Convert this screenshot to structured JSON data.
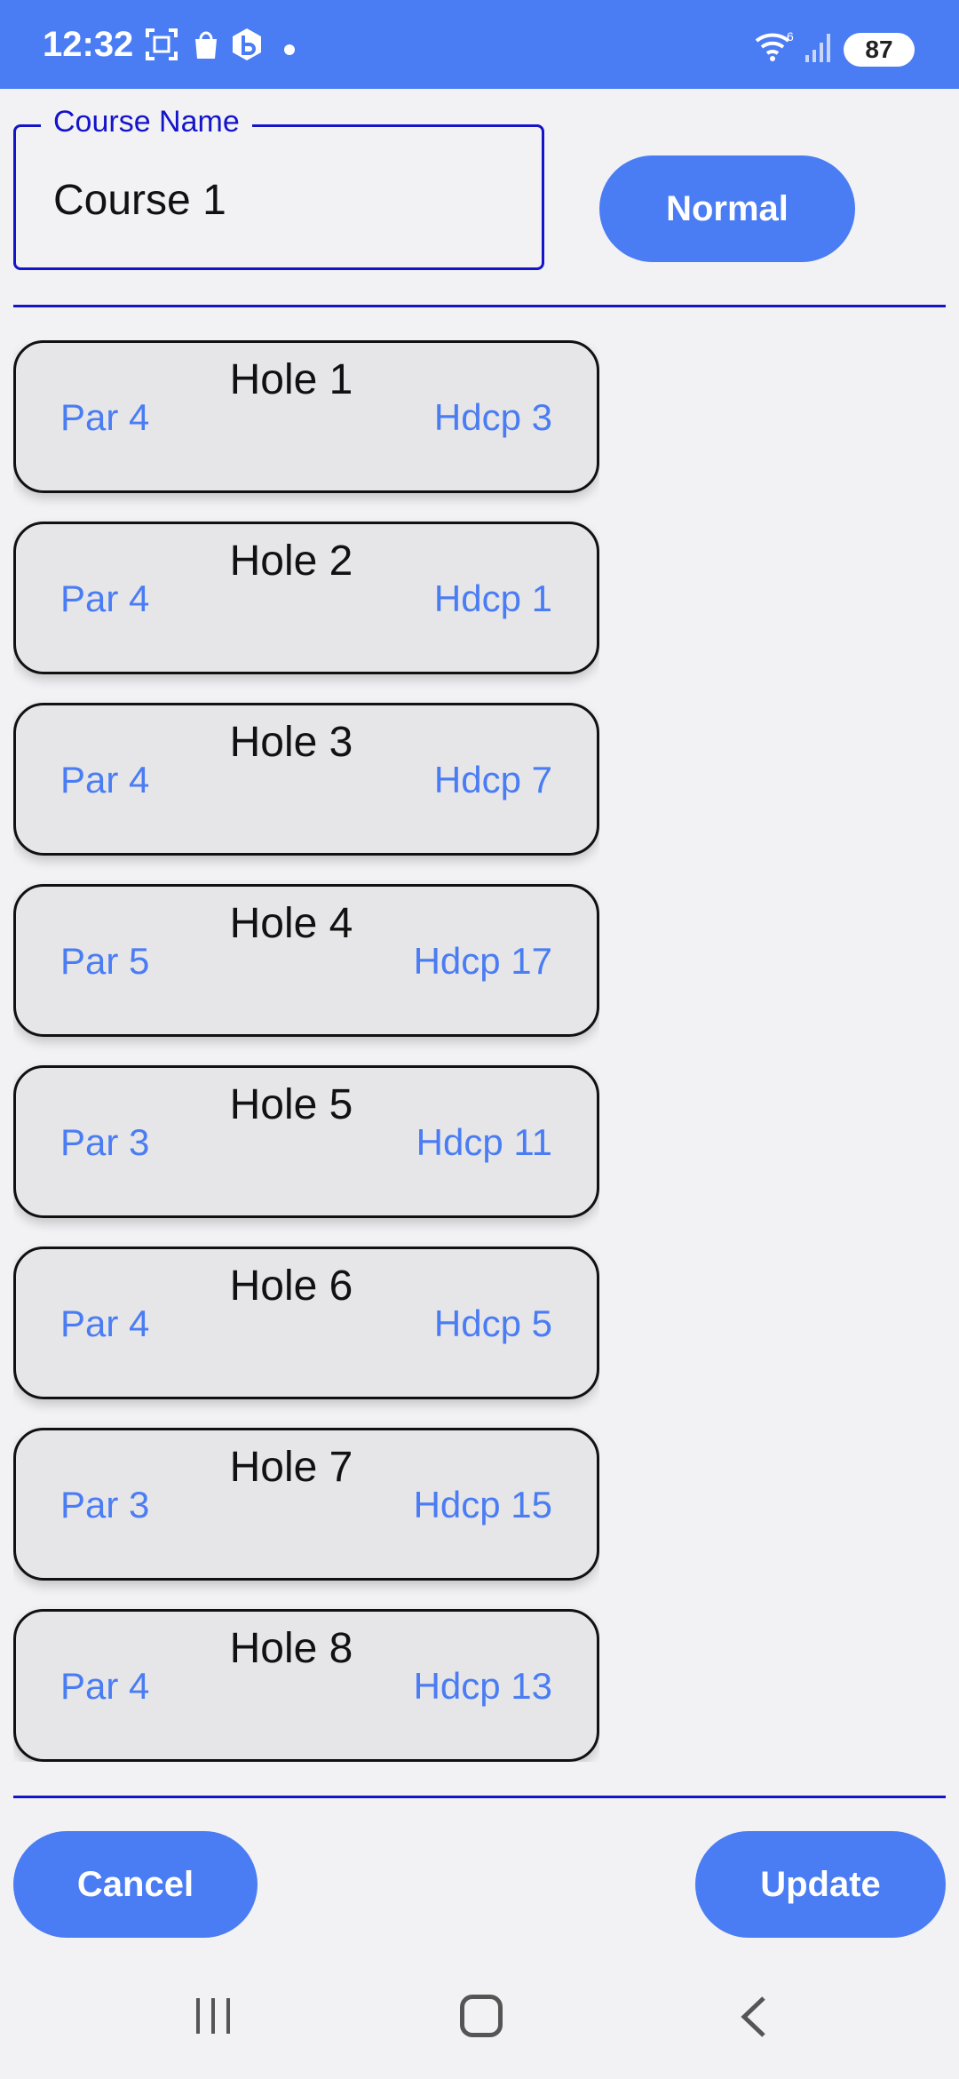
{
  "status_bar": {
    "time": "12:32",
    "battery": "87",
    "icons": [
      "screenshot-icon",
      "shopping-bag-icon",
      "b-app-icon",
      "notification-dot",
      "wifi-icon",
      "signal-icon",
      "battery-icon"
    ]
  },
  "course": {
    "field_label": "Course Name",
    "name_value": "Course 1",
    "mode_button": "Normal"
  },
  "holes": [
    {
      "title": "Hole 1",
      "par": "Par 4",
      "hdcp": "Hdcp 3"
    },
    {
      "title": "Hole 2",
      "par": "Par 4",
      "hdcp": "Hdcp 1"
    },
    {
      "title": "Hole 3",
      "par": "Par 4",
      "hdcp": "Hdcp 7"
    },
    {
      "title": "Hole 4",
      "par": "Par 5",
      "hdcp": "Hdcp 17"
    },
    {
      "title": "Hole 5",
      "par": "Par 3",
      "hdcp": "Hdcp 11"
    },
    {
      "title": "Hole 6",
      "par": "Par 4",
      "hdcp": "Hdcp 5"
    },
    {
      "title": "Hole 7",
      "par": "Par 3",
      "hdcp": "Hdcp 15"
    },
    {
      "title": "Hole 8",
      "par": "Par 4",
      "hdcp": "Hdcp 13"
    }
  ],
  "actions": {
    "cancel": "Cancel",
    "update": "Update"
  },
  "colors": {
    "accent": "#4a7cf3",
    "outline": "#1414c8",
    "card_bg": "#e6e6e9",
    "page_bg": "#f2f2f5"
  },
  "nav_bar": {
    "icons": [
      "recent-apps-icon",
      "home-icon",
      "back-icon"
    ]
  }
}
